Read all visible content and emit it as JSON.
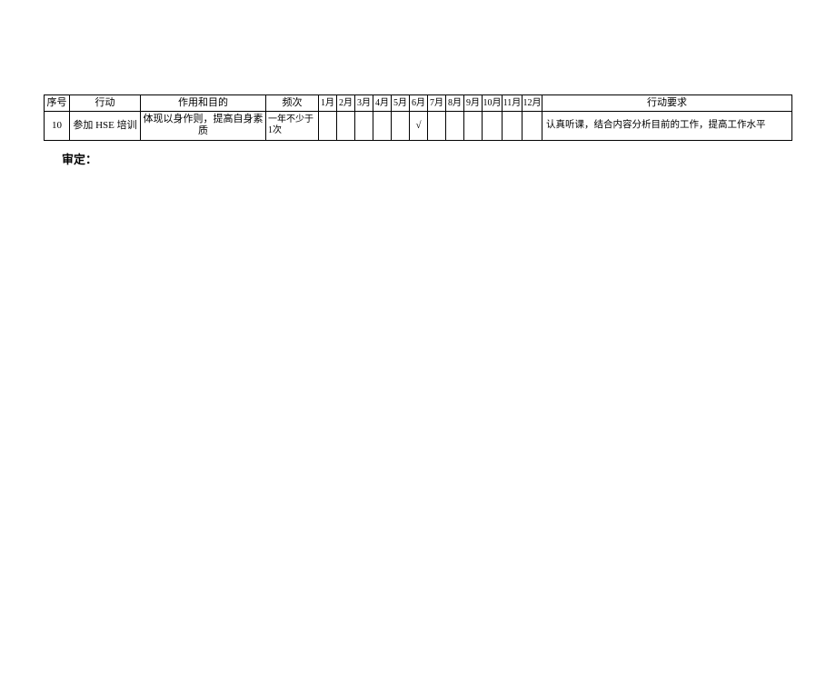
{
  "headers": {
    "seq": "序号",
    "action": "行动",
    "purpose": "作用和目的",
    "frequency": "频次",
    "months": {
      "m1": "1月",
      "m2": "2月",
      "m3": "3月",
      "m4": "4月",
      "m5": "5月",
      "m6": "6月",
      "m7": "7月",
      "m8": "8月",
      "m9": "9月",
      "m10": "10月",
      "m11": "11月",
      "m12": "12月"
    },
    "requirement": "行动要求"
  },
  "row": {
    "seq": "10",
    "action": "参加 HSE 培训",
    "purpose": "体现以身作则，提高自身素质",
    "frequency": "一年不少于1次",
    "months": {
      "m1": "",
      "m2": "",
      "m3": "",
      "m4": "",
      "m5": "",
      "m6": "√",
      "m7": "",
      "m8": "",
      "m9": "",
      "m10": "",
      "m11": "",
      "m12": ""
    },
    "requirement": "认真听课，结合内容分析目前的工作，提高工作水平"
  },
  "footer": {
    "label": "审定："
  }
}
